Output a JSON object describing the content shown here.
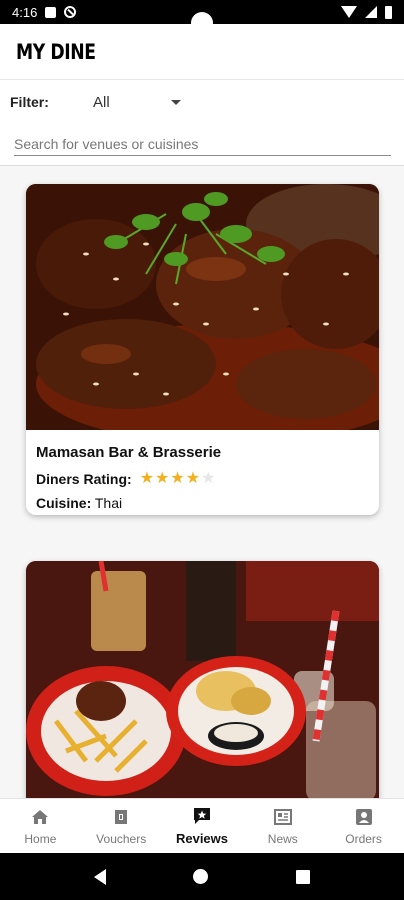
{
  "status_bar": {
    "time": "4:16"
  },
  "app": {
    "title": "MY DINE"
  },
  "filter": {
    "label": "Filter:",
    "selected": "All"
  },
  "search": {
    "placeholder": "Search for venues or cuisines",
    "value": ""
  },
  "venues": [
    {
      "name": "Mamasan Bar & Brasserie",
      "rating_label": "Diners Rating:",
      "rating": 4,
      "rating_max": 5,
      "cuisine_label": "Cuisine:",
      "cuisine": "Thai",
      "image": "glazed-chicken-wings-photo"
    },
    {
      "name": "",
      "image": "burger-fries-cocktails-photo"
    }
  ],
  "bottom_nav": [
    {
      "label": "Home",
      "icon": "home-icon",
      "active": false
    },
    {
      "label": "Vouchers",
      "icon": "voucher-icon",
      "active": false
    },
    {
      "label": "Reviews",
      "icon": "reviews-icon",
      "active": true
    },
    {
      "label": "News",
      "icon": "news-icon",
      "active": false
    },
    {
      "label": "Orders",
      "icon": "orders-icon",
      "active": false
    }
  ],
  "colors": {
    "star": "#f2b01e",
    "star_empty": "#e6e6e6",
    "active_nav": "#111111",
    "inactive_nav": "#777777"
  }
}
